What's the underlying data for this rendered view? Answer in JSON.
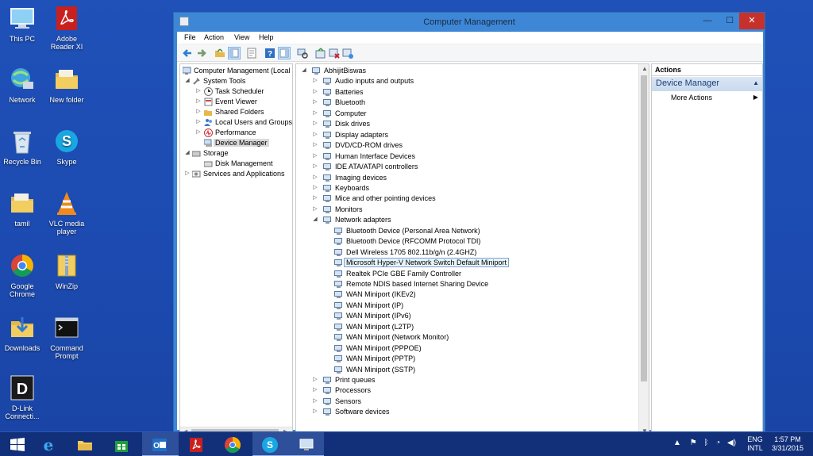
{
  "desktop": {
    "icons": [
      {
        "label": "This PC",
        "icon": "computer-icon"
      },
      {
        "label": "Adobe Reader XI",
        "icon": "adobe-reader-icon"
      },
      {
        "label": "Network",
        "icon": "network-icon"
      },
      {
        "label": "New folder",
        "icon": "folder-icon"
      },
      {
        "label": "Recycle Bin",
        "icon": "recycle-bin-icon"
      },
      {
        "label": "Skype",
        "icon": "skype-icon"
      },
      {
        "label": "tamil",
        "icon": "folder-icon"
      },
      {
        "label": "VLC media player",
        "icon": "vlc-icon"
      },
      {
        "label": "Google Chrome",
        "icon": "chrome-icon"
      },
      {
        "label": "WinZip",
        "icon": "winzip-icon"
      },
      {
        "label": "Downloads",
        "icon": "downloads-folder-icon"
      },
      {
        "label": "Command Prompt",
        "icon": "command-prompt-icon"
      },
      {
        "label": "D-Link Connecti...",
        "icon": "dlink-icon"
      }
    ]
  },
  "window": {
    "title": "Computer Management",
    "buttons": {
      "minimize": "—",
      "maximize": "☐",
      "close": "✕"
    },
    "menu": [
      "File",
      "Action",
      "View",
      "Help"
    ]
  },
  "left_tree": {
    "root": "Computer Management (Local",
    "system_tools": "System Tools",
    "children": [
      "Task Scheduler",
      "Event Viewer",
      "Shared Folders",
      "Local Users and Groups",
      "Performance",
      "Device Manager"
    ],
    "storage": "Storage",
    "disk_management": "Disk Management",
    "services": "Services and Applications"
  },
  "device_tree": {
    "root": "AbhijitBiswas",
    "categories_before": [
      "Audio inputs and outputs",
      "Batteries",
      "Bluetooth",
      "Computer",
      "Disk drives",
      "Display adapters",
      "DVD/CD-ROM drives",
      "Human Interface Devices",
      "IDE ATA/ATAPI controllers",
      "Imaging devices",
      "Keyboards",
      "Mice and other pointing devices",
      "Monitors"
    ],
    "network_adapters": "Network adapters",
    "adapters": [
      "Bluetooth Device (Personal Area Network)",
      "Bluetooth Device (RFCOMM Protocol TDI)",
      "Dell Wireless 1705 802.11b/g/n (2.4GHZ)",
      "Microsoft Hyper-V Network Switch Default Miniport",
      "Realtek PCIe GBE Family Controller",
      "Remote NDIS based Internet Sharing Device",
      "WAN Miniport (IKEv2)",
      "WAN Miniport (IP)",
      "WAN Miniport (IPv6)",
      "WAN Miniport (L2TP)",
      "WAN Miniport (Network Monitor)",
      "WAN Miniport (PPPOE)",
      "WAN Miniport (PPTP)",
      "WAN Miniport (SSTP)"
    ],
    "categories_after": [
      "Print queues",
      "Processors",
      "Sensors",
      "Software devices"
    ]
  },
  "actions": {
    "header": "Actions",
    "section": "Device Manager",
    "more": "More Actions"
  },
  "taskbar": {
    "lang_top": "ENG",
    "lang_bottom": "INTL",
    "time": "1:57 PM",
    "date": "3/31/2015"
  },
  "colors": {
    "desktop": "#1c4ab0",
    "window_frame": "#3d87d6",
    "close": "#c7312b",
    "taskbar": "#12307a",
    "selection": "#e5f3fb"
  }
}
